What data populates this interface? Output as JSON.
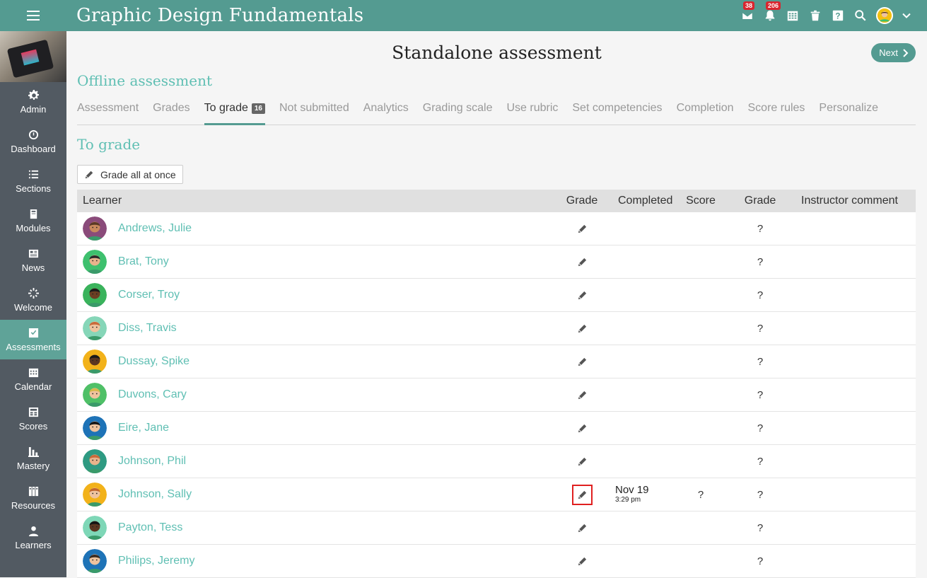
{
  "header": {
    "title": "Graphic Design Fundamentals",
    "messages_badge": "38",
    "notifications_badge": "206"
  },
  "sidebar": {
    "items": [
      {
        "label": "Admin",
        "icon": "gear-icon"
      },
      {
        "label": "Dashboard",
        "icon": "dashboard-icon"
      },
      {
        "label": "Sections",
        "icon": "list-icon"
      },
      {
        "label": "Modules",
        "icon": "book-icon"
      },
      {
        "label": "News",
        "icon": "newspaper-icon"
      },
      {
        "label": "Welcome",
        "icon": "spinner-icon"
      },
      {
        "label": "Assessments",
        "icon": "checkbox-icon"
      },
      {
        "label": "Calendar",
        "icon": "calendar-icon"
      },
      {
        "label": "Scores",
        "icon": "scores-icon"
      },
      {
        "label": "Mastery",
        "icon": "bar-chart-icon"
      },
      {
        "label": "Resources",
        "icon": "library-icon"
      },
      {
        "label": "Learners",
        "icon": "person-icon"
      }
    ],
    "active": "Assessments"
  },
  "page": {
    "title": "Standalone assessment",
    "next_label": "Next",
    "section_title": "Offline assessment",
    "subsection_title": "To grade",
    "grade_all_label": "Grade all at once"
  },
  "tabs": [
    {
      "label": "Assessment"
    },
    {
      "label": "Grades"
    },
    {
      "label": "To grade",
      "count": "16",
      "active": true
    },
    {
      "label": "Not submitted"
    },
    {
      "label": "Analytics"
    },
    {
      "label": "Grading scale"
    },
    {
      "label": "Use rubric"
    },
    {
      "label": "Set competencies"
    },
    {
      "label": "Completion"
    },
    {
      "label": "Score rules"
    },
    {
      "label": "Personalize"
    }
  ],
  "table": {
    "columns": {
      "learner": "Learner",
      "grade_action": "Grade",
      "completed": "Completed",
      "score": "Score",
      "grade": "Grade",
      "comment": "Instructor comment"
    },
    "rows": [
      {
        "name": "Andrews, Julie",
        "completed_date": "",
        "completed_time": "",
        "score": "",
        "grade": "?",
        "skin": "#c98a5e",
        "hair": "#5a3a25",
        "bg": "#8a4b7a",
        "highlight": false
      },
      {
        "name": "Brat, Tony",
        "completed_date": "",
        "completed_time": "",
        "score": "",
        "grade": "?",
        "skin": "#e8b38c",
        "hair": "#2a2a2a",
        "bg": "#3ec06e",
        "highlight": false
      },
      {
        "name": "Corser, Troy",
        "completed_date": "",
        "completed_time": "",
        "score": "",
        "grade": "?",
        "skin": "#6b3f23",
        "hair": "#1b1b1b",
        "bg": "#3ab35c",
        "highlight": false
      },
      {
        "name": "Diss, Travis",
        "completed_date": "",
        "completed_time": "",
        "score": "",
        "grade": "?",
        "skin": "#efc39e",
        "hair": "#c96a3a",
        "bg": "#86d6b8",
        "highlight": false
      },
      {
        "name": "Dussay, Spike",
        "completed_date": "",
        "completed_time": "",
        "score": "",
        "grade": "?",
        "skin": "#5a3520",
        "hair": "#1a1a1a",
        "bg": "#f2b21a",
        "highlight": false
      },
      {
        "name": "Duvons, Cary",
        "completed_date": "",
        "completed_time": "",
        "score": "",
        "grade": "?",
        "skin": "#efc39e",
        "hair": "#d8b84a",
        "bg": "#4fc067",
        "highlight": false
      },
      {
        "name": "Eire, Jane",
        "completed_date": "",
        "completed_time": "",
        "score": "",
        "grade": "?",
        "skin": "#efc39e",
        "hair": "#151515",
        "bg": "#1e73b7",
        "highlight": false
      },
      {
        "name": "Johnson, Phil",
        "completed_date": "",
        "completed_time": "",
        "score": "",
        "grade": "?",
        "skin": "#e8b38c",
        "hair": "#c96a3a",
        "bg": "#2e9a82",
        "highlight": false
      },
      {
        "name": "Johnson, Sally",
        "completed_date": "Nov 19",
        "completed_time": "3:29 pm",
        "score": "?",
        "grade": "?",
        "skin": "#efc39e",
        "hair": "#c1652d",
        "bg": "#f2b21a",
        "highlight": true
      },
      {
        "name": "Payton, Tess",
        "completed_date": "",
        "completed_time": "",
        "score": "",
        "grade": "?",
        "skin": "#5a3520",
        "hair": "#151515",
        "bg": "#7ed7b7",
        "highlight": false
      },
      {
        "name": "Philips, Jeremy",
        "completed_date": "",
        "completed_time": "",
        "score": "",
        "grade": "?",
        "skin": "#efc39e",
        "hair": "#3a2a20",
        "bg": "#1e73b7",
        "highlight": false
      }
    ]
  },
  "colors": {
    "brand": "#549b91",
    "accent_text": "#5fbfb3",
    "sidebar": "#525a62",
    "highlight_border": "#e02020"
  }
}
